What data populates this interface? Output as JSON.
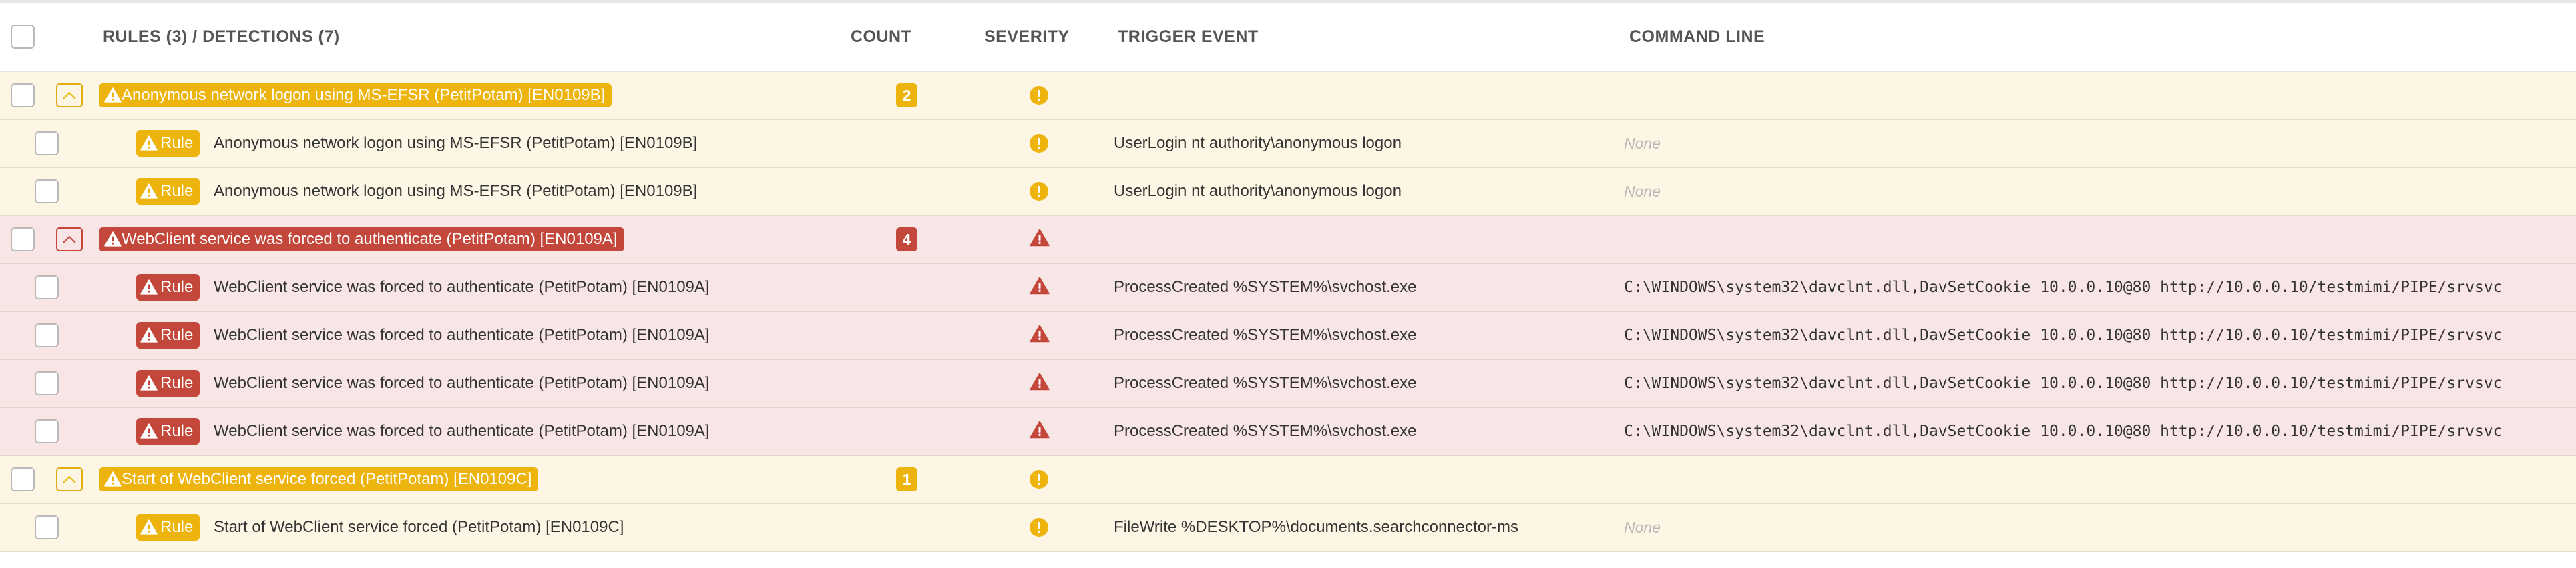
{
  "header": {
    "rules_detections": "RULES (3) / DETECTIONS (7)",
    "count": "COUNT",
    "severity": "SEVERITY",
    "trigger_event": "TRIGGER EVENT",
    "command_line": "COMMAND LINE"
  },
  "colors": {
    "warning_yellow": "#ecb40c",
    "critical_red": "#c3473b",
    "yellow_row_bg": "#fdf6e4",
    "red_row_bg": "#f7e6e5"
  },
  "groups": [
    {
      "label": "Anonymous network logon using MS-EFSR (PetitPotam) [EN0109B]",
      "count": "2",
      "severity": "warning",
      "children": [
        {
          "tag": "Rule",
          "name": "Anonymous network logon using MS-EFSR (PetitPotam) [EN0109B]",
          "trigger": "UserLogin nt authority\\anonymous logon",
          "command": "None"
        },
        {
          "tag": "Rule",
          "name": "Anonymous network logon using MS-EFSR (PetitPotam) [EN0109B]",
          "trigger": "UserLogin nt authority\\anonymous logon",
          "command": "None"
        }
      ]
    },
    {
      "label": "WebClient service was forced to authenticate (PetitPotam) [EN0109A]",
      "count": "4",
      "severity": "critical",
      "children": [
        {
          "tag": "Rule",
          "name": "WebClient service was forced to authenticate (PetitPotam) [EN0109A]",
          "trigger": "ProcessCreated %SYSTEM%\\svchost.exe",
          "command": "C:\\WINDOWS\\system32\\davclnt.dll,DavSetCookie 10.0.0.10@80 http://10.0.0.10/testmimi/PIPE/srvsvc"
        },
        {
          "tag": "Rule",
          "name": "WebClient service was forced to authenticate (PetitPotam) [EN0109A]",
          "trigger": "ProcessCreated %SYSTEM%\\svchost.exe",
          "command": "C:\\WINDOWS\\system32\\davclnt.dll,DavSetCookie 10.0.0.10@80 http://10.0.0.10/testmimi/PIPE/srvsvc"
        },
        {
          "tag": "Rule",
          "name": "WebClient service was forced to authenticate (PetitPotam) [EN0109A]",
          "trigger": "ProcessCreated %SYSTEM%\\svchost.exe",
          "command": "C:\\WINDOWS\\system32\\davclnt.dll,DavSetCookie 10.0.0.10@80 http://10.0.0.10/testmimi/PIPE/srvsvc"
        },
        {
          "tag": "Rule",
          "name": "WebClient service was forced to authenticate (PetitPotam) [EN0109A]",
          "trigger": "ProcessCreated %SYSTEM%\\svchost.exe",
          "command": "C:\\WINDOWS\\system32\\davclnt.dll,DavSetCookie 10.0.0.10@80 http://10.0.0.10/testmimi/PIPE/srvsvc"
        }
      ]
    },
    {
      "label": "Start of WebClient service forced (PetitPotam) [EN0109C]",
      "count": "1",
      "severity": "warning",
      "children": [
        {
          "tag": "Rule",
          "name": "Start of WebClient service forced (PetitPotam) [EN0109C]",
          "trigger": "FileWrite %DESKTOP%\\documents.searchconnector-ms",
          "command": "None"
        }
      ]
    }
  ]
}
